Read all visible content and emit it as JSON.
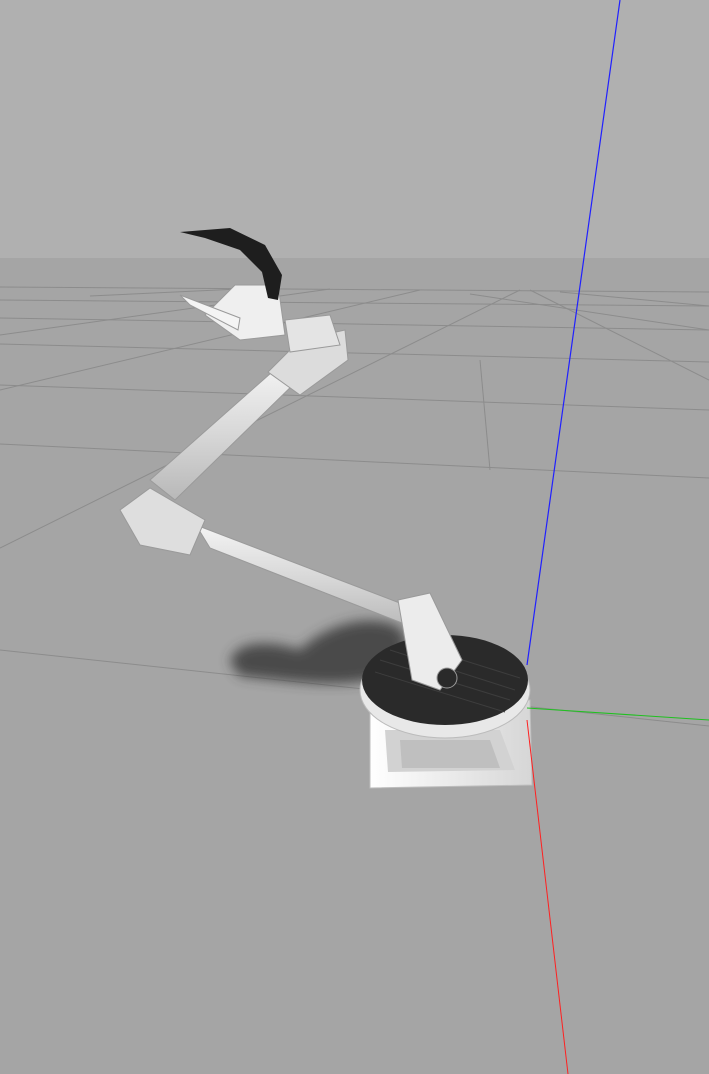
{
  "app": {
    "view": "3d-simulation-viewport"
  },
  "scene": {
    "colors": {
      "sky": "#b0b0b0",
      "ground": "#a5a5a5",
      "grid": "#8c8c8c",
      "axis_x": "#ff2020",
      "axis_y": "#20c020",
      "axis_z": "#2020ff",
      "arm_metal": "#e6e6e6",
      "arm_shade": "#bdbdbd",
      "turntable": "#2a2a2a",
      "gripper": "#1e1e1e",
      "base": "#f2f2f2",
      "shadow": "#3a3a3a"
    },
    "icons": [
      "robot-arm-model",
      "world-axes",
      "ground-grid"
    ]
  }
}
